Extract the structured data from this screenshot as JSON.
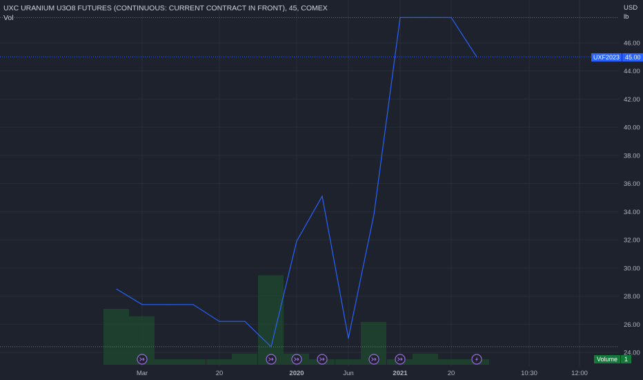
{
  "header": {
    "title": "UXC URANIUM U3O8 FUTURES (CONTINUOUS: CURRENT CONTRACT IN FRONT), 45, COMEX",
    "vol_label": "Vol"
  },
  "price_scale": {
    "currency": "USD",
    "unit": "lb"
  },
  "symbol_tag": {
    "symbol": "UXF2023",
    "value": "45.00"
  },
  "volume_tag": {
    "label": "Volume",
    "value": "1"
  },
  "colors": {
    "background": "#1e222d",
    "grid": "#2a2e39",
    "line": "#2962ff",
    "volume": "#1f4a2e",
    "event_icon": "#9c6ade",
    "axis_text": "#b2b5be"
  },
  "chart_data": {
    "type": "line",
    "title": "UXC URANIUM U3O8 FUTURES (CONTINUOUS: CURRENT CONTRACT IN FRONT), 45, COMEX",
    "ylim": [
      23.2,
      47.8
    ],
    "y_ticks": [
      "24.00",
      "26.00",
      "28.00",
      "30.00",
      "32.00",
      "34.00",
      "36.00",
      "38.00",
      "40.00",
      "42.00",
      "44.00",
      "46.00"
    ],
    "x_ticks": [
      "Mar",
      "20",
      "2020",
      "Jun",
      "2021",
      "20",
      "10:30",
      "12:00"
    ],
    "x_ticks_bold": [
      false,
      false,
      true,
      false,
      true,
      false,
      false,
      false
    ],
    "price": [
      28.5,
      27.4,
      27.4,
      27.4,
      26.2,
      26.2,
      24.4,
      31.9,
      35.1,
      25.0,
      33.8,
      47.8,
      47.8,
      47.8,
      45.0
    ],
    "volume": [
      3,
      2.6,
      0.3,
      0.3,
      0.3,
      0.6,
      4.8,
      0.6,
      0.3,
      0.3,
      2.3,
      0.3,
      0.6,
      0.3,
      0.3
    ],
    "grid": true,
    "last_price": 45.0,
    "low_price": 24.4,
    "high_price": 47.8,
    "events": [
      "split",
      "split",
      "split",
      "split",
      "split",
      "split",
      "flash"
    ]
  }
}
